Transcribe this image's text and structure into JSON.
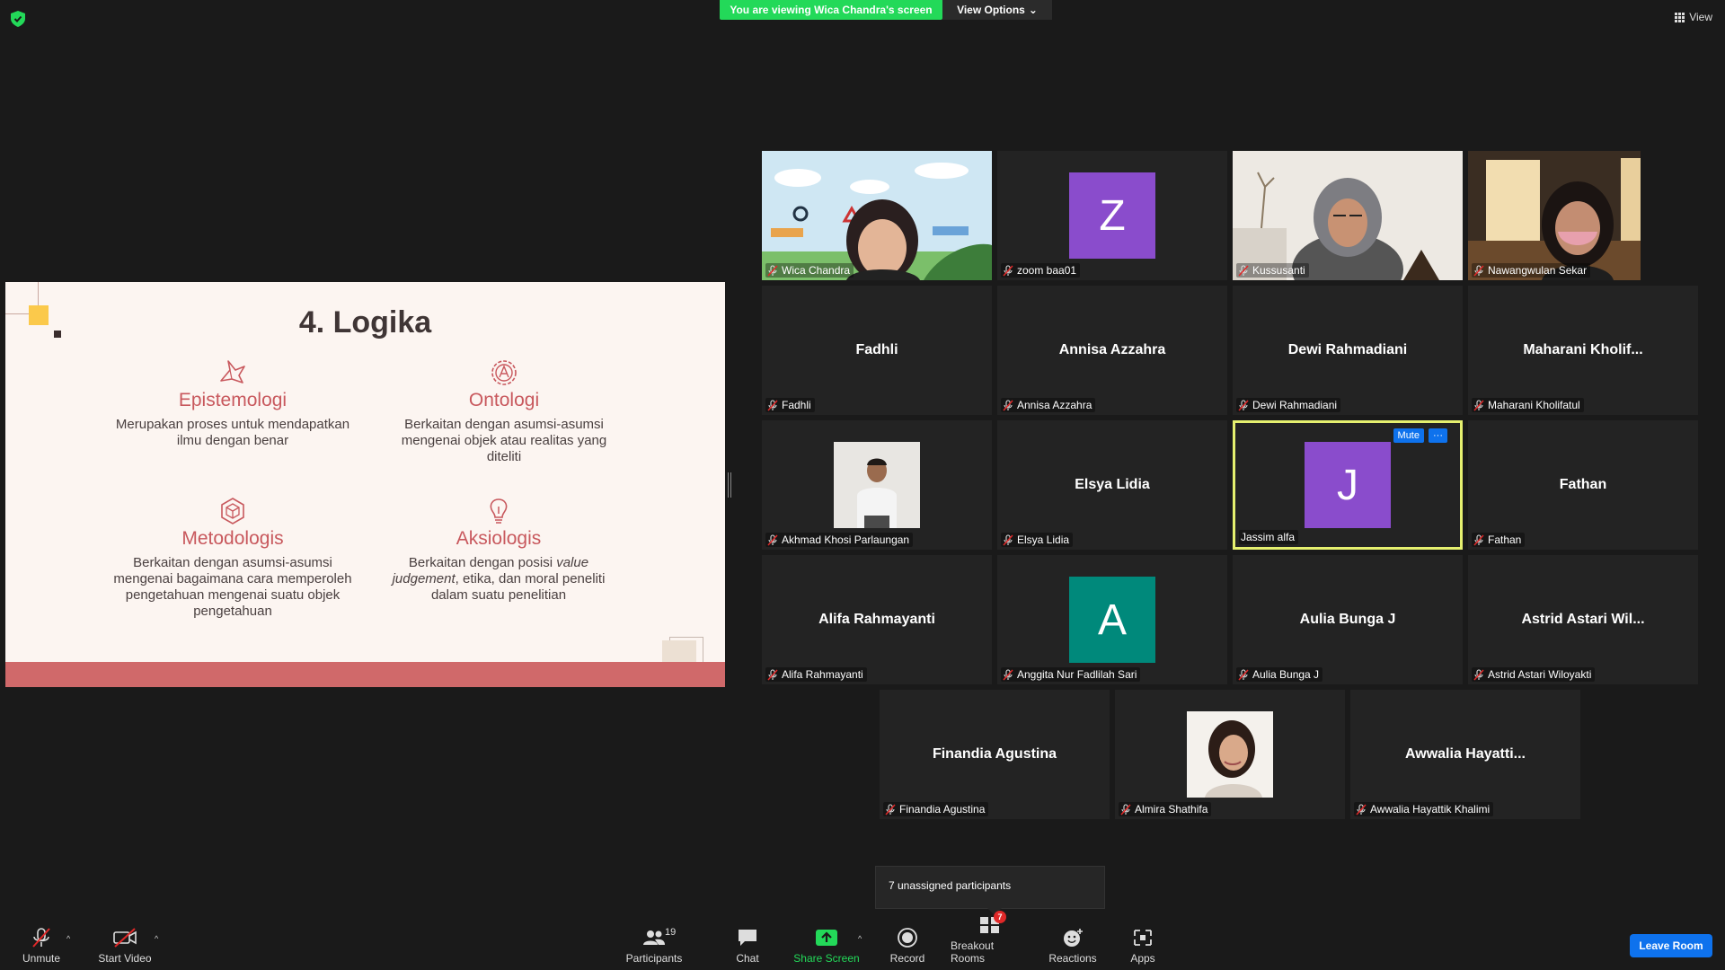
{
  "topbar": {
    "viewing_banner": "You are viewing Wica Chandra's screen",
    "view_options_label": "View Options",
    "view_label": "View"
  },
  "slide": {
    "title": "4. Logika",
    "concepts": [
      {
        "title": "Epistemologi",
        "desc": "Merupakan proses untuk mendapatkan ilmu dengan benar"
      },
      {
        "title": "Ontologi",
        "desc": "Berkaitan dengan asumsi-asumsi mengenai objek atau realitas yang diteliti"
      },
      {
        "title": "Metodologis",
        "desc": "Berkaitan dengan asumsi-asumsi mengenai bagaimana cara memperoleh pengetahuan mengenai suatu objek pengetahuan"
      },
      {
        "title": "Aksiologis",
        "desc_before": "Berkaitan dengan posisi ",
        "desc_italic": "value judgement",
        "desc_after": ", etika, dan moral peneliti dalam suatu penelitian"
      }
    ],
    "colors": {
      "accent": "#c8585d",
      "band": "#d0696a",
      "background": "#fcf5f1",
      "yellow": "#fbc94b"
    }
  },
  "participants": [
    {
      "label": "Wica Chandra",
      "type": "video"
    },
    {
      "label": "zoom baa01",
      "type": "avatar",
      "initial": "Z",
      "color": "#8a4ccc"
    },
    {
      "label": "Kussusanti",
      "type": "video"
    },
    {
      "label": "Nawangwulan Sekar",
      "type": "video"
    },
    {
      "label": "Fadhli",
      "center": "Fadhli",
      "type": "name"
    },
    {
      "label": "Annisa Azzahra",
      "center": "Annisa Azzahra",
      "type": "name"
    },
    {
      "label": "Dewi Rahmadiani",
      "center": "Dewi Rahmadiani",
      "type": "name"
    },
    {
      "label": "Maharani Kholifatul",
      "center": "Maharani  Kholif...",
      "type": "name"
    },
    {
      "label": "Akhmad Khosi Parlaungan",
      "type": "photo"
    },
    {
      "label": "Elsya Lidia",
      "center": "Elsya Lidia",
      "type": "name"
    },
    {
      "label": "Jassim alfa",
      "type": "avatar",
      "initial": "J",
      "color": "#8a4ccc",
      "active": true
    },
    {
      "label": "Fathan",
      "center": "Fathan",
      "type": "name"
    },
    {
      "label": "Alifa Rahmayanti",
      "center": "Alifa Rahmayanti",
      "type": "name"
    },
    {
      "label": "Anggita Nur Fadlilah Sari",
      "type": "avatar",
      "initial": "A",
      "color": "#00897b"
    },
    {
      "label": "Aulia Bunga J",
      "center": "Aulia Bunga J",
      "type": "name"
    },
    {
      "label": "Astrid Astari Wiloyakti",
      "center": "Astrid  Astari  Wil...",
      "type": "name"
    },
    {
      "label": "Finandia Agustina",
      "center": "Finandia Agustina",
      "type": "name"
    },
    {
      "label": "Almira Shathifa",
      "type": "photo"
    },
    {
      "label": "Awwalia Hayattik Khalimi",
      "center": "Awwalia  Hayatti...",
      "type": "name"
    }
  ],
  "active_tile": {
    "mute_label": "Mute",
    "more_label": "···"
  },
  "popup": {
    "unassigned": "7 unassigned participants"
  },
  "toolbar": {
    "unmute": "Unmute",
    "start_video": "Start Video",
    "participants": "Participants",
    "participants_count": "19",
    "chat": "Chat",
    "share_screen": "Share Screen",
    "record": "Record",
    "breakout_rooms": "Breakout Rooms",
    "breakout_badge": "7",
    "reactions": "Reactions",
    "apps": "Apps",
    "leave_room": "Leave Room"
  },
  "colors": {
    "share_green": "#23d959",
    "zoom_blue": "#0e72ed",
    "active_border": "#e5f06f",
    "badge_red": "#e02828"
  }
}
